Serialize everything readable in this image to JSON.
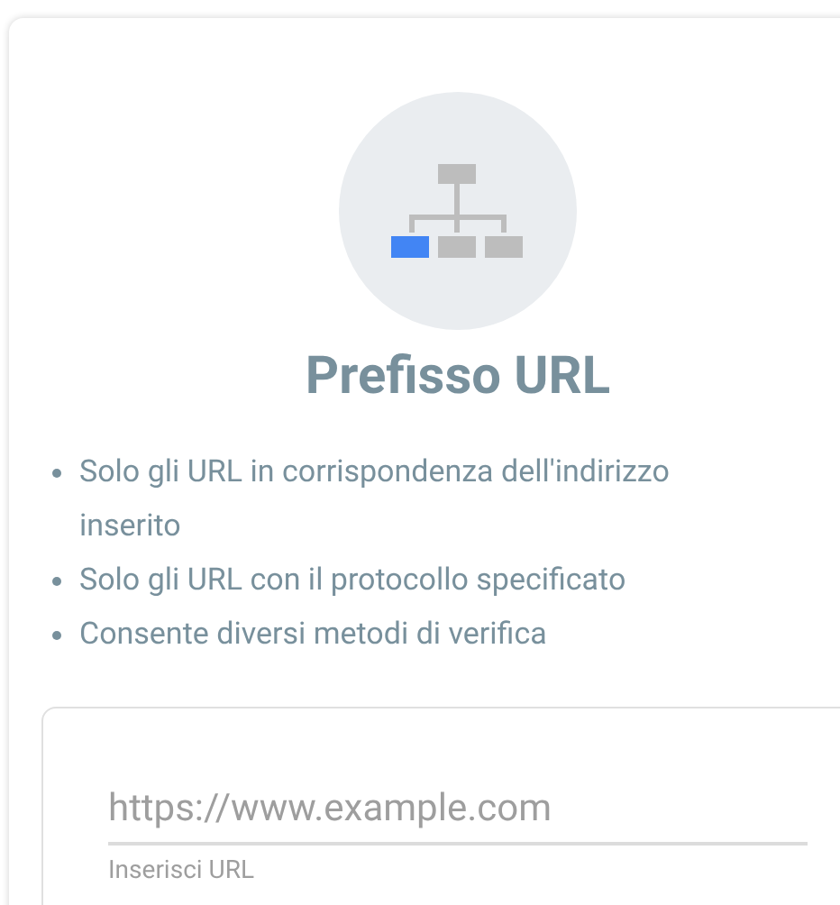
{
  "card": {
    "title": "Prefisso URL",
    "features": [
      "Solo gli URL in corrispondenza dell'indirizzo inserito",
      "Solo gli URL con il protocollo specificato",
      "Consente diversi metodi di verifica"
    ],
    "url_field": {
      "placeholder": "https://www.example.com",
      "helper": "Inserisci URL"
    }
  }
}
